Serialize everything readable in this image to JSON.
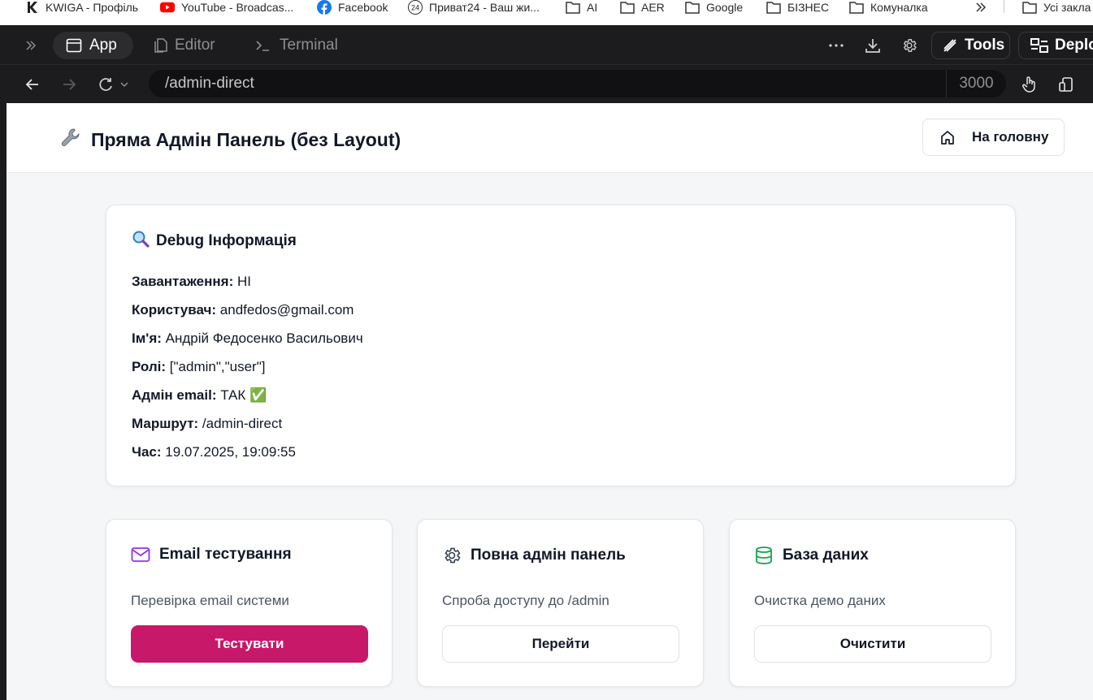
{
  "bookmarks": [
    {
      "label": "KWIGA - Профіль",
      "icon": "kwiga-icon"
    },
    {
      "label": "YouTube - Broadcas...",
      "icon": "youtube-icon"
    },
    {
      "label": "Facebook",
      "icon": "facebook-icon"
    },
    {
      "label": "Приват24 - Ваш жи...",
      "icon": "privat24-icon"
    },
    {
      "label": "AI",
      "icon": "folder-icon"
    },
    {
      "label": "AER",
      "icon": "folder-icon"
    },
    {
      "label": "Google",
      "icon": "folder-icon"
    },
    {
      "label": "БІЗНЕС",
      "icon": "folder-icon"
    },
    {
      "label": "Комуналка",
      "icon": "folder-icon"
    },
    {
      "label": "Усі закла",
      "icon": "folder-icon"
    }
  ],
  "privat_badge": "24",
  "topbar": {
    "tabs": {
      "app": "App",
      "editor": "Editor",
      "terminal": "Terminal"
    },
    "tools_label": "Tools",
    "deploy_label": "Deploy"
  },
  "urlbar": {
    "path": "/admin-direct",
    "port": "3000"
  },
  "header": {
    "title": "Пряма Адмін Панель (без Layout)",
    "home_button": "На головну"
  },
  "debug": {
    "title": "Debug Інформація",
    "rows": [
      {
        "label": "Завантаження:",
        "value": "НІ"
      },
      {
        "label": "Користувач:",
        "value": "andfedos@gmail.com"
      },
      {
        "label": "Ім'я:",
        "value": "Андрій Федосенко Васильович"
      },
      {
        "label": "Ролі:",
        "value": "[\"admin\",\"user\"]"
      },
      {
        "label": "Адмін email:",
        "value": "ТАК ✅"
      },
      {
        "label": "Маршрут:",
        "value": "/admin-direct"
      },
      {
        "label": "Час:",
        "value": "19.07.2025, 19:09:55"
      }
    ]
  },
  "cards": [
    {
      "title": "Email тестування",
      "description": "Перевірка email системи",
      "button": "Тестувати",
      "icon": "mail-icon",
      "icon_color": "#9333ea"
    },
    {
      "title": "Повна адмін панель",
      "description": "Спроба доступу до /admin",
      "button": "Перейти",
      "icon": "gear-icon",
      "icon_color": "#374151"
    },
    {
      "title": "База даних",
      "description": "Очистка демо даних",
      "button": "Очистити",
      "icon": "database-icon",
      "icon_color": "#16a34a"
    }
  ],
  "colors": {
    "primary_button": "#c8186a",
    "topbar_bg": "#1c1c1e"
  }
}
